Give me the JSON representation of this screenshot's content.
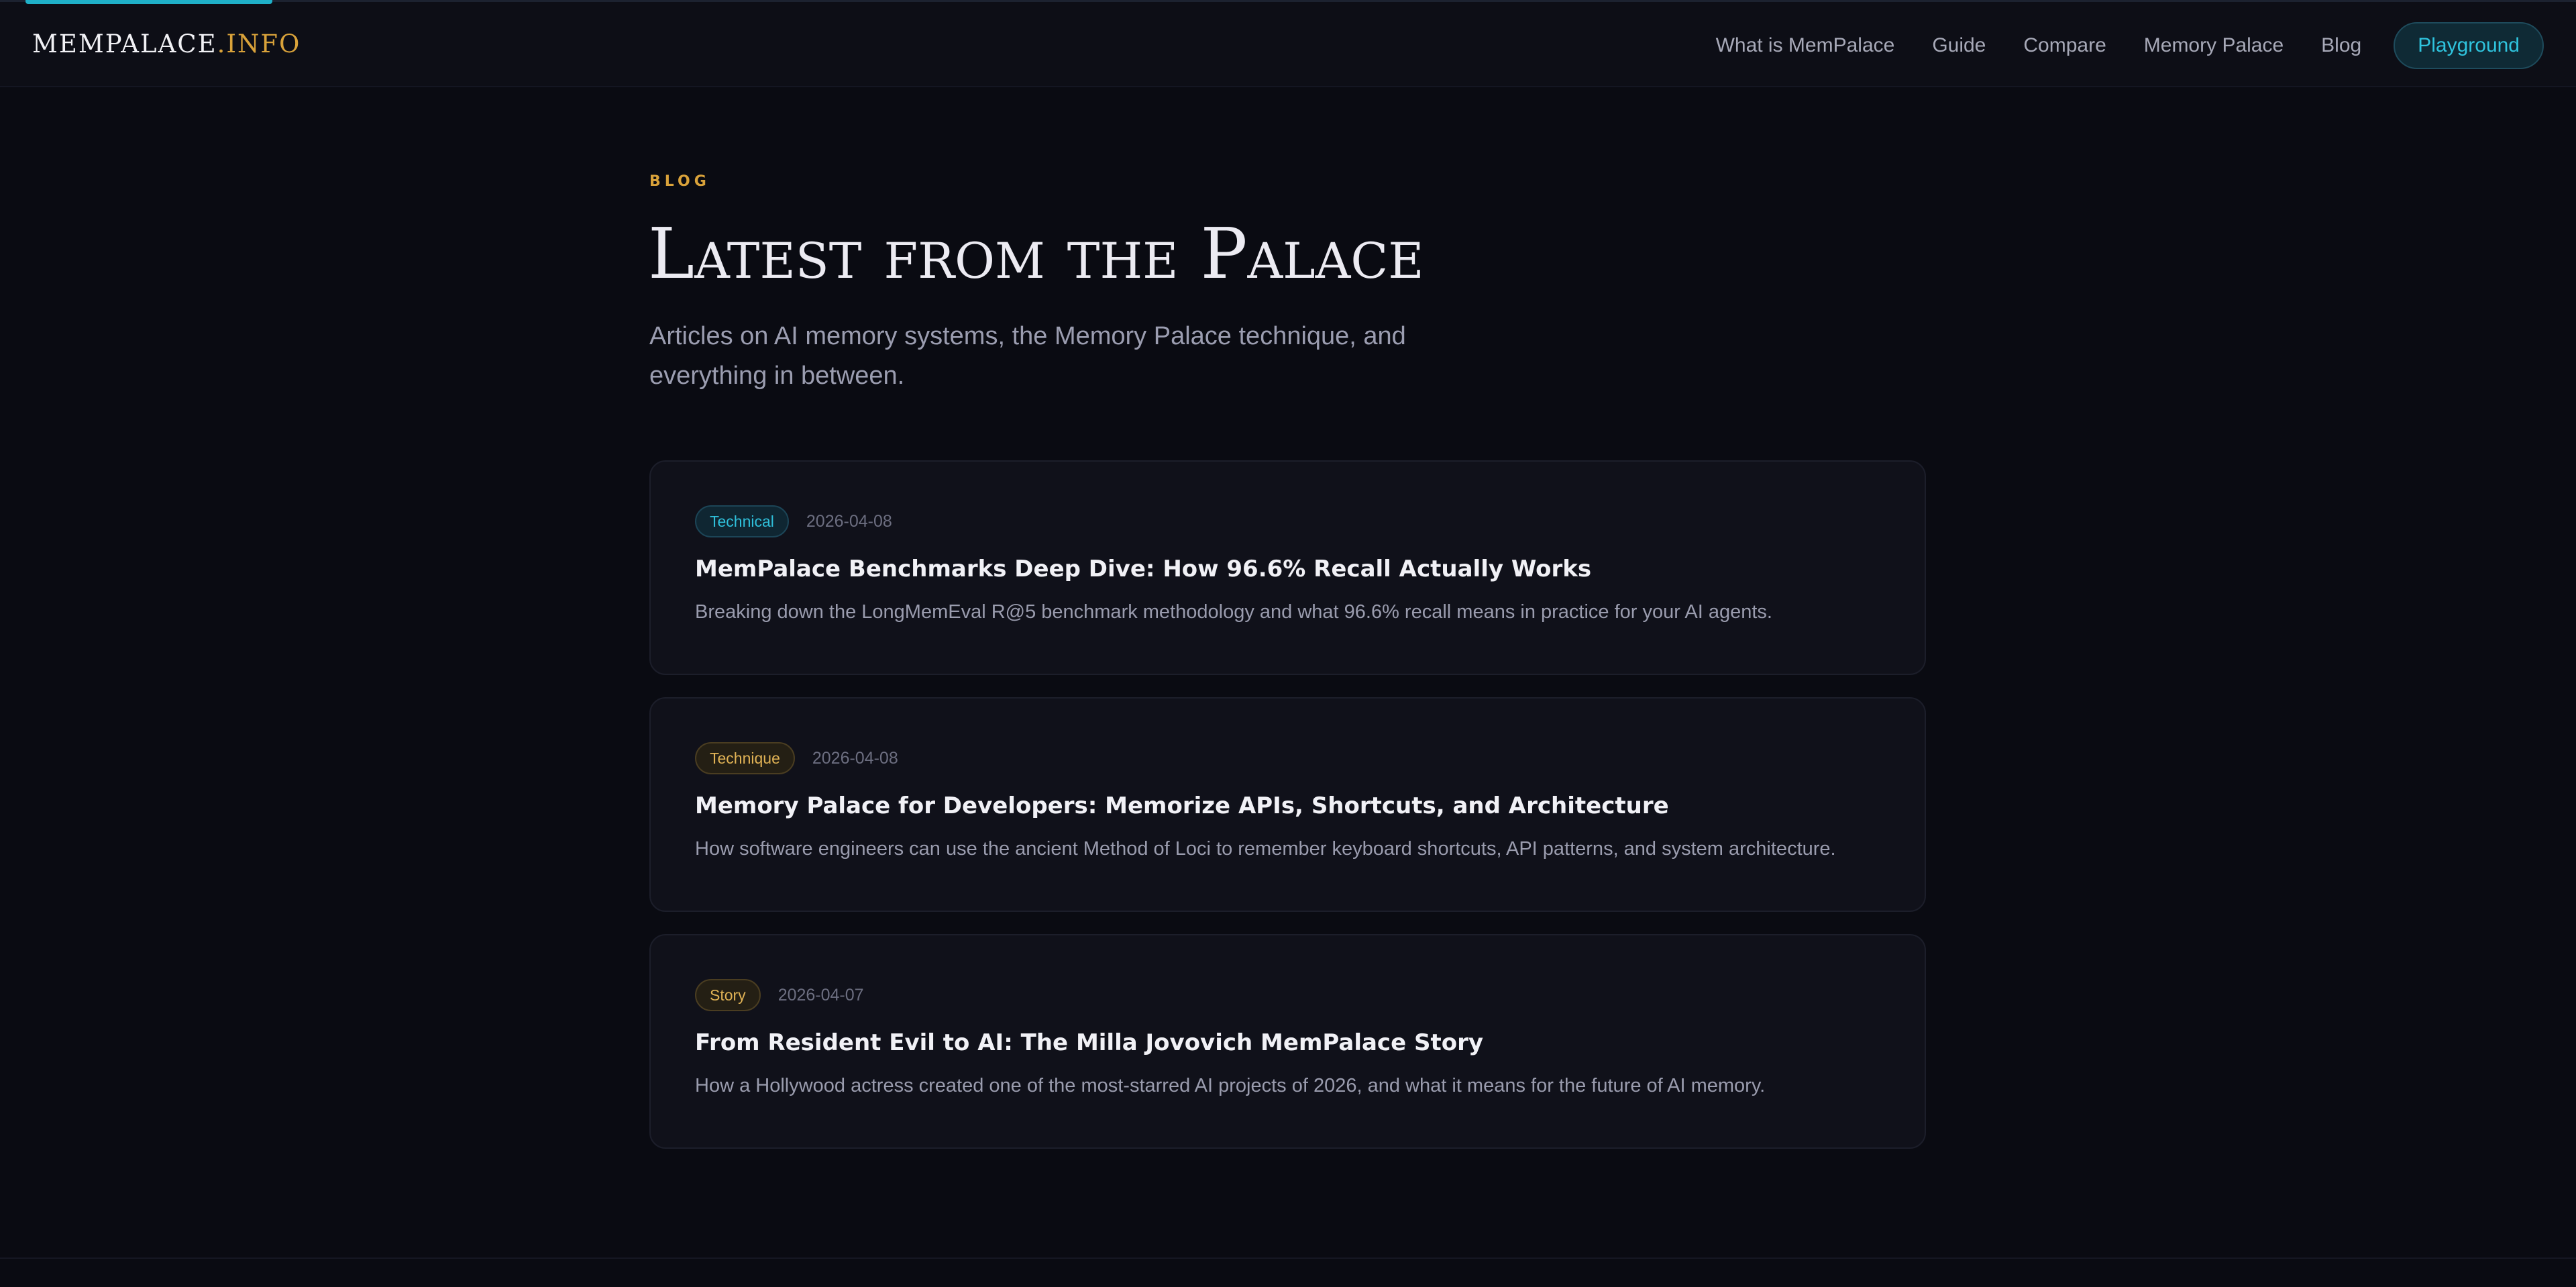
{
  "header": {
    "logo_main": "MEMPALACE",
    "logo_suffix": ".INFO",
    "nav": [
      "What is MemPalace",
      "Guide",
      "Compare",
      "Memory Palace",
      "Blog"
    ],
    "cta_label": "Playground"
  },
  "hero": {
    "eyebrow": "BLOG",
    "title": "Latest from the Palace",
    "subtitle": "Articles on AI memory systems, the Memory Palace technique, and everything in between."
  },
  "posts": [
    {
      "category": "Technical",
      "date": "2026-04-08",
      "title": "MemPalace Benchmarks Deep Dive: How 96.6% Recall Actually Works",
      "description": "Breaking down the LongMemEval R@5 benchmark methodology and what 96.6% recall means in practice for your AI agents."
    },
    {
      "category": "Technique",
      "date": "2026-04-08",
      "title": "Memory Palace for Developers: Memorize APIs, Shortcuts, and Architecture",
      "description": "How software engineers can use the ancient Method of Loci to remember keyboard shortcuts, API patterns, and system architecture."
    },
    {
      "category": "Story",
      "date": "2026-04-07",
      "title": "From Resident Evil to AI: The Milla Jovovich MemPalace Story",
      "description": "How a Hollywood actress created one of the most-starred AI projects of 2026, and what it means for the future of AI memory."
    }
  ],
  "colors": {
    "background": "#0a0b12",
    "accent_cyan": "#2fc4de",
    "accent_gold": "#d9a23a"
  }
}
